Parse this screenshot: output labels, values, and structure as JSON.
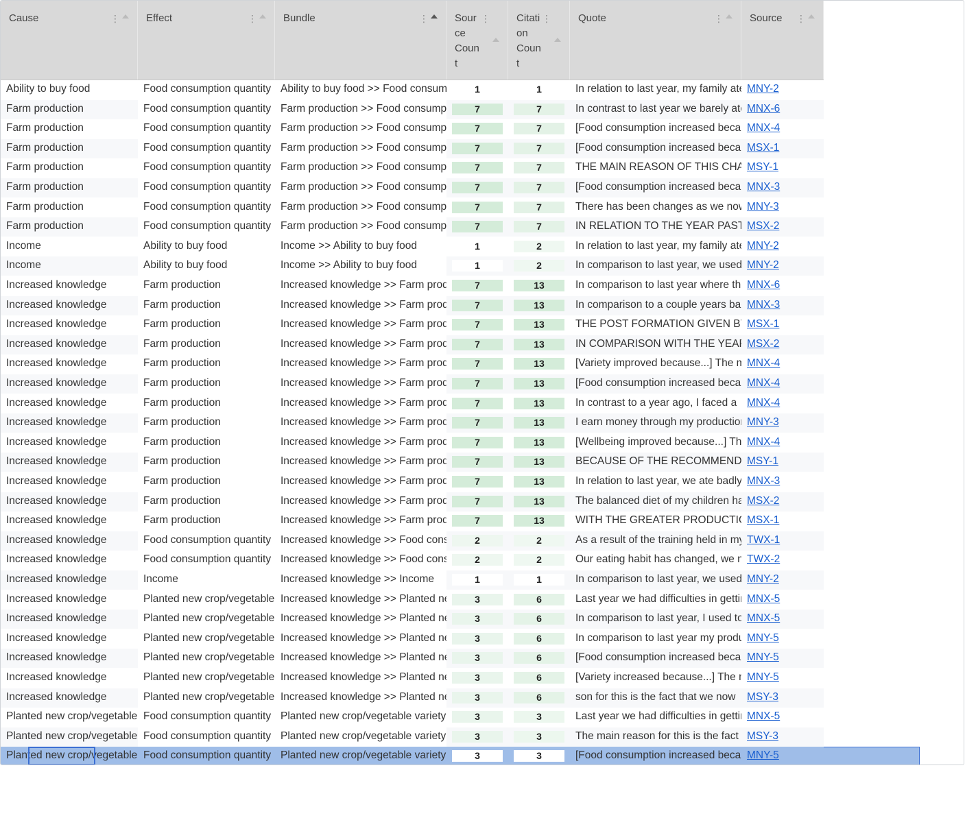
{
  "columns": [
    {
      "key": "cause",
      "label": "Cause"
    },
    {
      "key": "effect",
      "label": "Effect"
    },
    {
      "key": "bundle",
      "label": "Bundle"
    },
    {
      "key": "source_count",
      "label": "Sour\nce\nCoun\nt"
    },
    {
      "key": "citation_count",
      "label": "Citati\non\nCoun\nt"
    },
    {
      "key": "quote",
      "label": "Quote"
    },
    {
      "key": "source",
      "label": "Source"
    }
  ],
  "colors": {
    "header_bg": "#d9d9d9",
    "selected_row": "#9fbde8",
    "link": "#1a5fd0",
    "count_green": "#d4ecd9"
  },
  "rows": [
    {
      "cause": "Ability to buy food",
      "effect": "Food consumption quantity",
      "bundle": "Ability to buy food >> Food consumption quantity",
      "source_count": "1",
      "citation_count": "1",
      "quote": "In relation to last year, my family ate",
      "source": "MNY-2"
    },
    {
      "cause": "Farm production",
      "effect": "Food consumption quantity",
      "bundle": "Farm production >> Food consumption quantity",
      "source_count": "7",
      "citation_count": "7",
      "quote": "In contrast to last year we barely ate",
      "source": "MNX-6"
    },
    {
      "cause": "Farm production",
      "effect": "Food consumption quantity",
      "bundle": "Farm production >> Food consumption quantity",
      "source_count": "7",
      "citation_count": "7",
      "quote": "[Food consumption increased because",
      "source": "MNX-4"
    },
    {
      "cause": "Farm production",
      "effect": "Food consumption quantity",
      "bundle": "Farm production >> Food consumption quantity",
      "source_count": "7",
      "citation_count": "7",
      "quote": "[Food consumption increased because",
      "source": "MSX-1"
    },
    {
      "cause": "Farm production",
      "effect": "Food consumption quantity",
      "bundle": "Farm production >> Food consumption quantity",
      "source_count": "7",
      "citation_count": "7",
      "quote": "THE MAIN REASON OF THIS CHANGE",
      "source": "MSY-1"
    },
    {
      "cause": "Farm production",
      "effect": "Food consumption quantity",
      "bundle": "Farm production >> Food consumption quantity",
      "source_count": "7",
      "citation_count": "7",
      "quote": "[Food consumption increased because",
      "source": "MNX-3"
    },
    {
      "cause": "Farm production",
      "effect": "Food consumption quantity",
      "bundle": "Farm production >> Food consumption quantity",
      "source_count": "7",
      "citation_count": "7",
      "quote": "There has been changes as we now",
      "source": "MNY-3"
    },
    {
      "cause": "Farm production",
      "effect": "Food consumption quantity",
      "bundle": "Farm production >> Food consumption quantity",
      "source_count": "7",
      "citation_count": "7",
      "quote": "IN RELATION TO THE YEAR PAST THE",
      "source": "MSX-2"
    },
    {
      "cause": "Income",
      "effect": "Ability to buy food",
      "bundle": "Income >> Ability to buy food",
      "source_count": "1",
      "citation_count": "2",
      "quote": "In relation to last year, my family ate",
      "source": "MNY-2"
    },
    {
      "cause": "Income",
      "effect": "Ability to buy food",
      "bundle": "Income >> Ability to buy food",
      "source_count": "1",
      "citation_count": "2",
      "quote": "In comparison to last year, we used",
      "source": "MNY-2"
    },
    {
      "cause": "Increased knowledge",
      "effect": "Farm production",
      "bundle": "Increased knowledge >> Farm production",
      "source_count": "7",
      "citation_count": "13",
      "quote": "In comparison to last year where the",
      "source": "MNX-6"
    },
    {
      "cause": "Increased knowledge",
      "effect": "Farm production",
      "bundle": "Increased knowledge >> Farm production",
      "source_count": "7",
      "citation_count": "13",
      "quote": "In comparison to a couple years back",
      "source": "MNX-3"
    },
    {
      "cause": "Increased knowledge",
      "effect": "Farm production",
      "bundle": "Increased knowledge >> Farm production",
      "source_count": "7",
      "citation_count": "13",
      "quote": "THE POST FORMATION GIVEN BY ORG",
      "source": "MSX-1"
    },
    {
      "cause": "Increased knowledge",
      "effect": "Farm production",
      "bundle": "Increased knowledge >> Farm production",
      "source_count": "7",
      "citation_count": "13",
      "quote": "IN COMPARISON WITH THE YEAR PAST",
      "source": "MSX-2"
    },
    {
      "cause": "Increased knowledge",
      "effect": "Farm production",
      "bundle": "Increased knowledge >> Farm production",
      "source_count": "7",
      "citation_count": "13",
      "quote": "[Variety improved because...] The main",
      "source": "MNX-4"
    },
    {
      "cause": "Increased knowledge",
      "effect": "Farm production",
      "bundle": "Increased knowledge >> Farm production",
      "source_count": "7",
      "citation_count": "13",
      "quote": "[Food consumption increased because",
      "source": "MNX-4"
    },
    {
      "cause": "Increased knowledge",
      "effect": "Farm production",
      "bundle": "Increased knowledge >> Farm production",
      "source_count": "7",
      "citation_count": "13",
      "quote": "In contrast to a year ago, I faced a",
      "source": "MNX-4"
    },
    {
      "cause": "Increased knowledge",
      "effect": "Farm production",
      "bundle": "Increased knowledge >> Farm production",
      "source_count": "7",
      "citation_count": "13",
      "quote": "I earn money through my production",
      "source": "MNY-3"
    },
    {
      "cause": "Increased knowledge",
      "effect": "Farm production",
      "bundle": "Increased knowledge >> Farm production",
      "source_count": "7",
      "citation_count": "13",
      "quote": "[Wellbeing improved because...] The",
      "source": "MNX-4"
    },
    {
      "cause": "Increased knowledge",
      "effect": "Farm production",
      "bundle": "Increased knowledge >> Farm production",
      "source_count": "7",
      "citation_count": "13",
      "quote": "BECAUSE OF THE RECOMMENDATIONS",
      "source": "MSY-1"
    },
    {
      "cause": "Increased knowledge",
      "effect": "Farm production",
      "bundle": "Increased knowledge >> Farm production",
      "source_count": "7",
      "citation_count": "13",
      "quote": "In relation to last year, we ate badly",
      "source": "MNX-3"
    },
    {
      "cause": "Increased knowledge",
      "effect": "Farm production",
      "bundle": "Increased knowledge >> Farm production",
      "source_count": "7",
      "citation_count": "13",
      "quote": "The balanced diet of my children has",
      "source": "MSX-2"
    },
    {
      "cause": "Increased knowledge",
      "effect": "Farm production",
      "bundle": "Increased knowledge >> Farm production",
      "source_count": "7",
      "citation_count": "13",
      "quote": "WITH THE GREATER PRODUCTION OF",
      "source": "MSX-1"
    },
    {
      "cause": "Increased knowledge",
      "effect": "Food consumption quantity",
      "bundle": "Increased knowledge >> Food consumption quantity",
      "source_count": "2",
      "citation_count": "2",
      "quote": "As a result of the training held in my",
      "source": "TWX-1"
    },
    {
      "cause": "Increased knowledge",
      "effect": "Food consumption quantity",
      "bundle": "Increased knowledge >> Food consumption quantity",
      "source_count": "2",
      "citation_count": "2",
      "quote": "Our eating habit has changed, we now",
      "source": "TWX-2"
    },
    {
      "cause": "Increased knowledge",
      "effect": "Income",
      "bundle": "Increased knowledge >> Income",
      "source_count": "1",
      "citation_count": "1",
      "quote": "In comparison to last year, we used",
      "source": "MNY-2"
    },
    {
      "cause": "Increased knowledge",
      "effect": "Planted new crop/vegetable variety",
      "bundle": "Increased knowledge >> Planted new crop/vegetable variety",
      "source_count": "3",
      "citation_count": "6",
      "quote": "Last year we had difficulties in getting",
      "source": "MNX-5"
    },
    {
      "cause": "Increased knowledge",
      "effect": "Planted new crop/vegetable variety",
      "bundle": "Increased knowledge >> Planted new crop/vegetable variety",
      "source_count": "3",
      "citation_count": "6",
      "quote": "In comparison to last year, I used to",
      "source": "MNX-5"
    },
    {
      "cause": "Increased knowledge",
      "effect": "Planted new crop/vegetable variety",
      "bundle": "Increased knowledge >> Planted new crop/vegetable variety",
      "source_count": "3",
      "citation_count": "6",
      "quote": "In comparison to last year my produce",
      "source": "MNY-5"
    },
    {
      "cause": "Increased knowledge",
      "effect": "Planted new crop/vegetable variety",
      "bundle": "Increased knowledge >> Planted new crop/vegetable variety",
      "source_count": "3",
      "citation_count": "6",
      "quote": "[Food consumption increased because",
      "source": "MNY-5"
    },
    {
      "cause": "Increased knowledge",
      "effect": "Planted new crop/vegetable variety",
      "bundle": "Increased knowledge >> Planted new crop/vegetable variety",
      "source_count": "3",
      "citation_count": "6",
      "quote": "[Variety increased because...] The main",
      "source": "MNY-5"
    },
    {
      "cause": "Increased knowledge",
      "effect": "Planted new crop/vegetable variety",
      "bundle": "Increased knowledge >> Planted new crop/vegetable variety",
      "source_count": "3",
      "citation_count": "6",
      "quote": "son for this is the fact that we now",
      "source": "MSY-3"
    },
    {
      "cause": "Planted new crop/vegetable variety",
      "effect": "Food consumption quantity",
      "bundle": "Planted new crop/vegetable variety >> Food consumption quantity",
      "source_count": "3",
      "citation_count": "3",
      "quote": "Last year we had difficulties in getting",
      "source": "MNX-5"
    },
    {
      "cause": "Planted new crop/vegetable variety",
      "effect": "Food consumption quantity",
      "bundle": "Planted new crop/vegetable variety >> Food consumption quantity",
      "source_count": "3",
      "citation_count": "3",
      "quote": "The main reason for this is the fact",
      "source": "MSY-3"
    },
    {
      "cause": "Planted new crop/vegetable variety",
      "effect": "Food consumption quantity",
      "bundle": "Planted new crop/vegetable variety >> Food consumption quantity",
      "source_count": "3",
      "citation_count": "3",
      "quote": "[Food consumption increased because",
      "source": "MNY-5"
    }
  ],
  "count_fill": {
    "source_count": {
      "1": 0,
      "2": 0.2,
      "3": 0.35,
      "7": 1
    },
    "citation_count": {
      "1": 0,
      "2": 0.15,
      "3": 0.25,
      "6": 0.5,
      "7": 0.55,
      "13": 1
    }
  },
  "selected_row_index": 34,
  "sorted_column": "bundle"
}
